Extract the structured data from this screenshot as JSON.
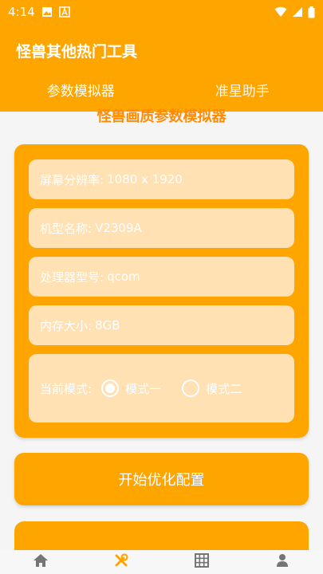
{
  "status": {
    "time": "4:14"
  },
  "colors": {
    "accent": "#ffa500",
    "field_bg": "#ffe1b3",
    "title": "#ff8c00"
  },
  "header": {
    "title": "怪兽其他热门工具"
  },
  "tabs": [
    {
      "label": "参数模拟器",
      "active": true
    },
    {
      "label": "准星助手",
      "active": false
    }
  ],
  "section": {
    "title": "怪兽画质参数模拟器"
  },
  "fields": {
    "resolution": {
      "label": "屏幕分辨率:",
      "value": "1080 x 1920"
    },
    "model": {
      "label": "机型名称:",
      "value": "V2309A"
    },
    "processor": {
      "label": "处理器型号:",
      "value": "qcom"
    },
    "memory": {
      "label": "内存大小:",
      "value": "8GB"
    },
    "mode": {
      "label": "当前模式:",
      "options": [
        {
          "label": "模式一",
          "selected": true
        },
        {
          "label": "模式二",
          "selected": false
        }
      ]
    }
  },
  "actions": {
    "start_label": "开始优化配置"
  },
  "bottom_nav": [
    {
      "icon": "home-icon"
    },
    {
      "icon": "tools-icon"
    },
    {
      "icon": "grid-icon"
    },
    {
      "icon": "person-icon"
    }
  ]
}
